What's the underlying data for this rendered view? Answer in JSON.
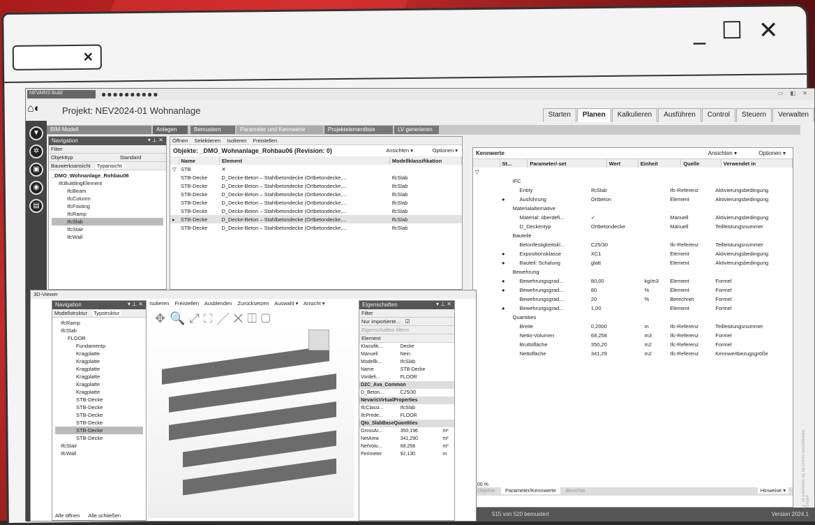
{
  "app": {
    "nev": "NEVARIS Build",
    "project": "Projekt: NEV2024-01 Wohnanlage",
    "version": "Version 2024.1"
  },
  "tabs": [
    "Starten",
    "Planen",
    "Kalkulieren",
    "Ausführen",
    "Control",
    "Steuern",
    "Verwalten"
  ],
  "ribbon": [
    "BIM-Modell",
    "Anlegen",
    "Bemustern",
    "Parameter und Kennwerte",
    "Projektelementliste",
    "LV generieren"
  ],
  "nav": {
    "title": "Navigation",
    "filter": "Filter",
    "objekttyp": "Objekttyp",
    "standard": "Standard",
    "tab1": "Bauwerksansicht",
    "tab2": "Typansicht",
    "items": [
      "_DMO_Wohnanlage_Rohbau06",
      "IfcBuildingElement",
      "IfcBeam",
      "IfcColumn",
      "IfcFooting",
      "IfcRamp",
      "IfcSlab",
      "IfcStair",
      "IfcWall"
    ]
  },
  "objects": {
    "toolbar": [
      "Öffnen",
      "Selektieren",
      "Isolieren",
      "Freistellen"
    ],
    "title": "Objekte: _DMO_Wohnanlage_Rohbau06 (Revision: 0)",
    "ansichten": "Ansichten ▾",
    "optionen": "Optionen ▾",
    "headers": [
      "Name",
      "Element",
      "Modellklassifikation"
    ],
    "filter": "STB",
    "rows": [
      [
        "STB-Decke",
        "D_Decke-Beton – Stahlbetondecke (Ortbetondecke,...",
        "IfcSlab"
      ],
      [
        "STB-Decke",
        "D_Decke-Beton – Stahlbetondecke (Ortbetondecke,...",
        "IfcSlab"
      ],
      [
        "STB-Decke",
        "D_Decke-Beton – Stahlbetondecke (Ortbetondecke,...",
        "IfcSlab"
      ],
      [
        "STB-Decke",
        "D_Decke-Beton – Stahlbetondecke (Ortbetondecke,...",
        "IfcSlab"
      ],
      [
        "STB-Decke",
        "D_Decke-Beton – Stahlbetondecke (Ortbetondecke,...",
        "IfcSlab"
      ],
      [
        "STB-Decke",
        "D_Decke-Beton – Stahlbetondecke (Ortbetondecke,...",
        "IfcSlab"
      ],
      [
        "STB-Decke",
        "D_Decke-Beton – Stahlbetondecke (Ortbetondecke,...",
        "IfcSlab"
      ]
    ]
  },
  "kennwerte": {
    "title": "Kennwerte",
    "ansichten": "Ansichten ▾",
    "optionen": "Optionen ▾",
    "headers": [
      "St...",
      "Parameter/-set",
      "Wert",
      "Einheit",
      "Quelle",
      "Verwendet in"
    ],
    "rows": [
      [
        "",
        "IFC",
        "",
        "",
        "",
        ""
      ],
      [
        "",
        "Entity",
        "IfcSlab",
        "",
        "Ifc-Referenz",
        "Aktivierungsbedingung"
      ],
      [
        "●",
        "Ausführung",
        "Ortbeton",
        "",
        "Element",
        "Aktivierungsbedingung"
      ],
      [
        "",
        "Materialalternative",
        "",
        "",
        "",
        ""
      ],
      [
        "",
        "Material: überdefi...",
        "✓",
        "",
        "Manuell",
        "Aktivierungsbedingung"
      ],
      [
        "",
        "D_Deckentyp",
        "Ortbetondecke",
        "",
        "Manuell",
        "Teilleistungsnummer"
      ],
      [
        "",
        "Bauteile",
        "",
        "",
        "",
        ""
      ],
      [
        "",
        "Betonfestigkeitskl...",
        "C25/30",
        "",
        "Ifc-Referenz",
        "Teilleistungsnummer"
      ],
      [
        "●",
        "Expositionsklasse",
        "XC1",
        "",
        "Element",
        "Aktivierungsbedingung"
      ],
      [
        "●",
        "Bauteil: Schalung",
        "glatt",
        "",
        "Element",
        "Aktivierungsbedingung"
      ],
      [
        "",
        "Bewehrung",
        "",
        "",
        "",
        ""
      ],
      [
        "●",
        "Bewehrungsgrad...",
        "80,00",
        "kg/m3",
        "Element",
        "Formel"
      ],
      [
        "●",
        "Bewehrungsgrad...",
        "80",
        "%",
        "Element",
        "Formel"
      ],
      [
        "",
        "Bewehrungsgrad...",
        "20",
        "%",
        "Berechnet",
        "Formel"
      ],
      [
        "●",
        "Bewehrungsgrad...",
        "1,00",
        "",
        "Element",
        "Formel"
      ],
      [
        "",
        "Quantities",
        "",
        "",
        "",
        ""
      ],
      [
        "",
        "Breite",
        "0,2000",
        "m",
        "Ifc-Referenz",
        "Teilleistungsnummer"
      ],
      [
        "",
        "Netto-Volumen",
        "68,258",
        "m3",
        "Ifc-Referenz",
        "Formel"
      ],
      [
        "",
        "Bruttofläche",
        "350,20",
        "m2",
        "Ifc-Referenz",
        "Formel"
      ],
      [
        "",
        "Nettofläche",
        "341,29",
        "m2",
        "Ifc-Referenz",
        "Kennwertbezugsgröße"
      ]
    ],
    "zoom": "100 %",
    "tabs": [
      "Objekte",
      "Parameter/Kennwerte",
      "Berichte"
    ],
    "hinweise": "Hinweise ▾",
    "status": "515 von 520 bemustert"
  },
  "viewer": {
    "title": "3D-Viewer",
    "nav": "Navigation",
    "tab1": "Modellstruktur",
    "tab2": "Typstruktur",
    "toolbar": [
      "Isolieren",
      "Freistellen",
      "Ausblenden",
      "Zurücksetzen",
      "Auswahl ▾",
      "Ansicht ▾"
    ],
    "tree": [
      "IfcRamp",
      "IfcSlab",
      "FLOOR",
      "Fundamentp",
      "Kragplatte",
      "Kragplatte",
      "Kragplatte",
      "Kragplatte",
      "Kragplatte",
      "Kragplatte",
      "STB-Decke",
      "STB-Decke",
      "STB-Decke",
      "STB-Decke",
      "STB-Decke",
      "STB-Decke",
      "IfcStair",
      "IfcWall"
    ],
    "open_all": "Alle öffnen",
    "close_all": "Alle schließen"
  },
  "props": {
    "title": "Eigenschaften",
    "filter": "Filter",
    "imported": "Nur importierte...",
    "placeholder": "Eigenschaften filtern",
    "element": "Element",
    "rows": [
      [
        "Klassifik...",
        "Decke"
      ],
      [
        "Manuell",
        "Nein"
      ],
      [
        "Modellk...",
        "IfcSlab"
      ],
      [
        "Name",
        "STB-Decke"
      ],
      [
        "Vordefi...",
        "FLOOR"
      ]
    ],
    "g1": "D2C_Ava_Common",
    "g1rows": [
      [
        "D_Beton...",
        "C25/30"
      ]
    ],
    "g2": "NevarisVirtualProperties",
    "g2rows": [
      [
        "IfcClassi...",
        "IfcSlab"
      ],
      [
        "IfcPrede...",
        "FLOOR"
      ]
    ],
    "g3": "Qto_SlabBaseQuantities",
    "g3rows": [
      [
        "GrossAr...",
        "350,196",
        "m²"
      ],
      [
        "NetArea",
        "341,290",
        "m²"
      ],
      [
        "NetVolu...",
        "68,258",
        "m³"
      ],
      [
        "Perimeter",
        "92,130",
        "m"
      ]
    ]
  },
  "copyright": "© UI-Elemente by NEVARIS Bausoftware GmbH"
}
